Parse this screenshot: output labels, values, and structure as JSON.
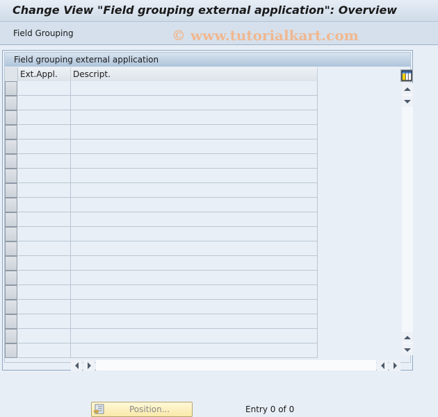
{
  "window": {
    "title": "Change View \"Field grouping external application\": Overview"
  },
  "toolbar": {
    "items": [
      {
        "label": "Field Grouping"
      }
    ]
  },
  "watermark": "© www.tutorialkart.com",
  "table": {
    "title": "Field grouping external application",
    "columns": [
      {
        "key": "ext_appl",
        "label": "Ext.Appl."
      },
      {
        "key": "descript",
        "label": "Descript."
      }
    ],
    "rows": [
      {
        "ext_appl": "",
        "descript": ""
      },
      {
        "ext_appl": "",
        "descript": ""
      },
      {
        "ext_appl": "",
        "descript": ""
      },
      {
        "ext_appl": "",
        "descript": ""
      },
      {
        "ext_appl": "",
        "descript": ""
      },
      {
        "ext_appl": "",
        "descript": ""
      },
      {
        "ext_appl": "",
        "descript": ""
      },
      {
        "ext_appl": "",
        "descript": ""
      },
      {
        "ext_appl": "",
        "descript": ""
      },
      {
        "ext_appl": "",
        "descript": ""
      },
      {
        "ext_appl": "",
        "descript": ""
      },
      {
        "ext_appl": "",
        "descript": ""
      },
      {
        "ext_appl": "",
        "descript": ""
      },
      {
        "ext_appl": "",
        "descript": ""
      },
      {
        "ext_appl": "",
        "descript": ""
      },
      {
        "ext_appl": "",
        "descript": ""
      },
      {
        "ext_appl": "",
        "descript": ""
      },
      {
        "ext_appl": "",
        "descript": ""
      },
      {
        "ext_appl": "",
        "descript": ""
      }
    ],
    "icons": {
      "column_config": "table-settings-icon",
      "scroll_up": "arrow-up-icon",
      "scroll_down": "arrow-down-icon",
      "scroll_left": "arrow-left-icon",
      "scroll_right": "arrow-right-icon"
    }
  },
  "footer": {
    "position_button": {
      "label": "Position...",
      "icon": "position-icon",
      "enabled": false
    },
    "entry_status": "Entry 0 of 0"
  }
}
